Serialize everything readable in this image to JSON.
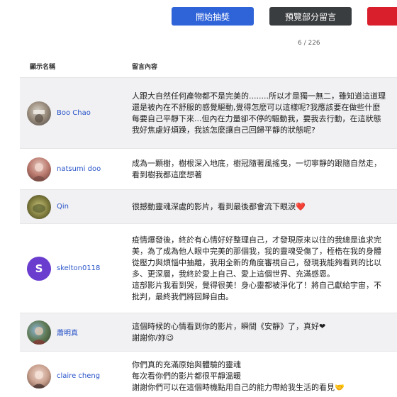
{
  "actions": {
    "draw_label": "開始抽獎",
    "preview_label": "預覽部分留言",
    "red_label": ""
  },
  "pager": {
    "text": "6 / 226"
  },
  "table": {
    "col_name": "顯示名稱",
    "col_msg": "留言內容",
    "rows": [
      {
        "name": "Boo Chao",
        "lines": [
          "人跟大自然任何產物都不是完美的........所以才是獨一無二，雖知道這道理",
          "還是被內在不舒服的感覺驅動,覺得怎麼可以這樣呢?我應該要在做些什麼",
          "每要自己平靜下來...但內在力量卻不停的驅動我，要我去行動，在這狀態",
          "我好焦慮好煩躁，我該怎麼讓自己回歸平靜的狀態呢?"
        ]
      },
      {
        "name": "natsumi doo",
        "lines": [
          "成為一顆樹，樹根深入地底，樹冠隨著風搖曳，一切寧靜的跟隨自然走，",
          "看到樹我都這麼想著"
        ]
      },
      {
        "name": "Qin",
        "lines": [
          "很撼動靈魂深處的影片，看到最後都會流下眼淚❤️"
        ]
      },
      {
        "name": "skelton0118",
        "initial": "S",
        "lines": [
          "疫情爆發後，終於有心情好好整理自己，才發現原來以往的我總是追求完",
          "美，為了成為他人眼中完美的那個我，我的靈魂受傷了，桎梏在我的身體",
          "從壓力與煩惱中抽離，我用全新的角度審視自己，發現我能夠看到的比以",
          "多、更深層，我終於愛上自己、愛上這個世界、充滿感恩。",
          "這部影片我看到哭，覺得很美！身心靈都被淨化了！將自己獻給宇宙，不",
          "批判，最終我們將回歸自由。"
        ]
      },
      {
        "name": "蕭明真",
        "lines": [
          "這個時候的心情看到你的影片，瞬間《安靜》了，真好❤",
          "謝謝你/妳😉"
        ]
      },
      {
        "name": "claire cheng",
        "lines": [
          "你們真的充滿原始與體驗的靈魂",
          "每次看你們的影片都很平靜溫暖",
          "謝謝你們可以在這個時機點用自己的能力帶給我生活的看見🤝"
        ]
      }
    ]
  },
  "colors": {
    "accent_blue": "#2f63d8",
    "dark_button": "#3a3d40",
    "red_button": "#d91f2b",
    "name_link": "#2a55c9",
    "skelton_avatar": "#6a3dcf"
  },
  "icons": {
    "boo_chao": "photo-avatar",
    "natsumi_doo": "photo-avatar",
    "qin": "photo-avatar",
    "skelton0118": "letter-avatar",
    "hsiao": "photo-avatar",
    "claire": "photo-avatar"
  }
}
